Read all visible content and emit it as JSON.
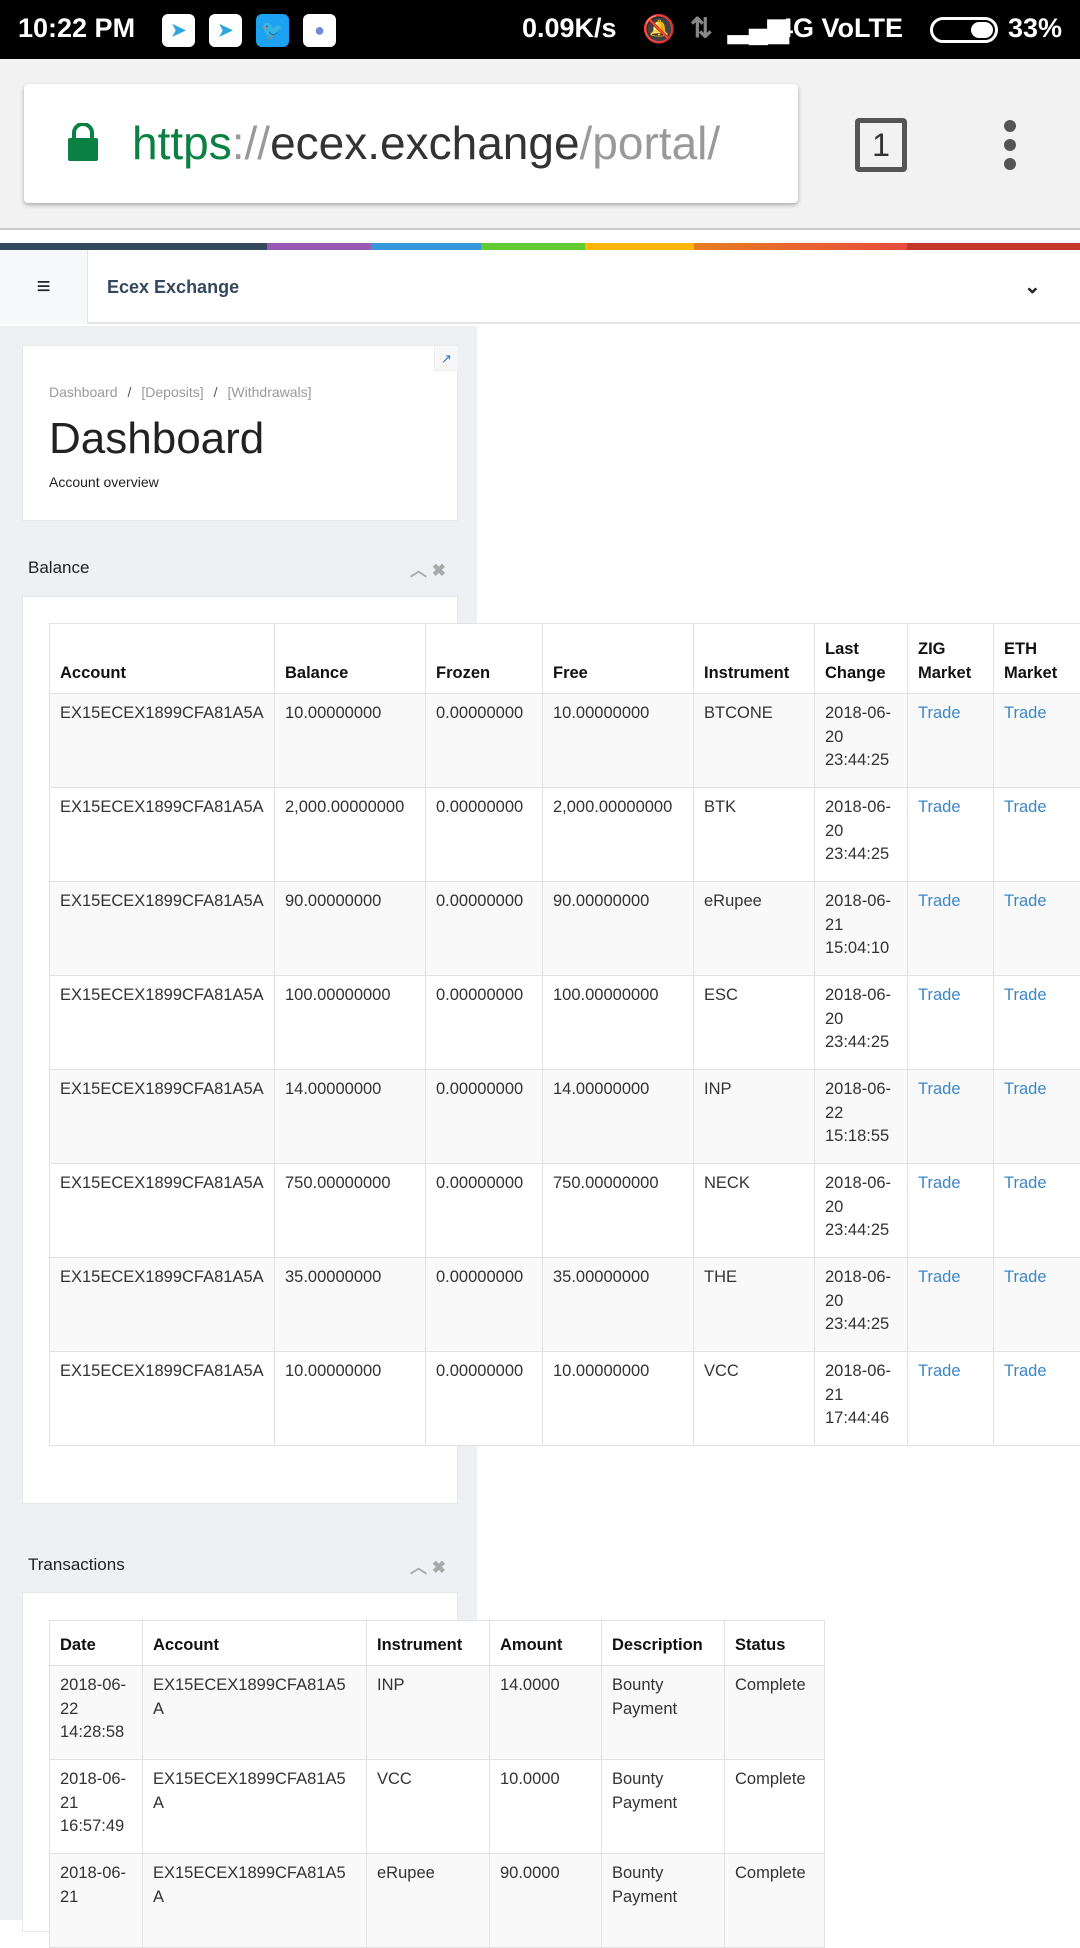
{
  "status_bar": {
    "time": "10:22 PM",
    "speed": "0.09K/s",
    "network": "4G VoLTE",
    "battery": "33%",
    "notifications": [
      "telegram-icon",
      "telegram-icon",
      "twitter-icon",
      "discord-icon"
    ]
  },
  "browser": {
    "url_scheme": "https",
    "url_sep": "://",
    "url_host": "ecex.exchange",
    "url_path": "/portal/",
    "tab_count": "1"
  },
  "colors": {
    "strip": [
      "#34495e",
      "#9b59b6",
      "#3498db",
      "#62cb31",
      "#ffb606",
      "#e67e22",
      "#e74c3c",
      "#c0392b"
    ],
    "link": "#3a87c8"
  },
  "header": {
    "brand": "Ecex Exchange"
  },
  "page": {
    "breadcrumb": [
      "Dashboard",
      "[Deposits]",
      "[Withdrawals]"
    ],
    "title": "Dashboard",
    "subtitle": "Account overview"
  },
  "balance": {
    "title": "Balance",
    "columns": [
      "Account",
      "Balance",
      "Frozen",
      "Free",
      "Instrument",
      "Last Change",
      "ZIG Market",
      "ETH Market"
    ],
    "rows": [
      [
        "EX15ECEX1899CFA81A5A",
        "10.00000000",
        "0.00000000",
        "10.00000000",
        "BTCONE",
        "2018-06-20 23:44:25",
        "Trade",
        "Trade"
      ],
      [
        "EX15ECEX1899CFA81A5A",
        "2,000.00000000",
        "0.00000000",
        "2,000.00000000",
        "BTK",
        "2018-06-20 23:44:25",
        "Trade",
        "Trade"
      ],
      [
        "EX15ECEX1899CFA81A5A",
        "90.00000000",
        "0.00000000",
        "90.00000000",
        "eRupee",
        "2018-06-21 15:04:10",
        "Trade",
        "Trade"
      ],
      [
        "EX15ECEX1899CFA81A5A",
        "100.00000000",
        "0.00000000",
        "100.00000000",
        "ESC",
        "2018-06-20 23:44:25",
        "Trade",
        "Trade"
      ],
      [
        "EX15ECEX1899CFA81A5A",
        "14.00000000",
        "0.00000000",
        "14.00000000",
        "INP",
        "2018-06-22 15:18:55",
        "Trade",
        "Trade"
      ],
      [
        "EX15ECEX1899CFA81A5A",
        "750.00000000",
        "0.00000000",
        "750.00000000",
        "NECK",
        "2018-06-20 23:44:25",
        "Trade",
        "Trade"
      ],
      [
        "EX15ECEX1899CFA81A5A",
        "35.00000000",
        "0.00000000",
        "35.00000000",
        "THE",
        "2018-06-20 23:44:25",
        "Trade",
        "Trade"
      ],
      [
        "EX15ECEX1899CFA81A5A",
        "10.00000000",
        "0.00000000",
        "10.00000000",
        "VCC",
        "2018-06-21 17:44:46",
        "Trade",
        "Trade"
      ]
    ]
  },
  "transactions": {
    "title": "Transactions",
    "columns": [
      "Date",
      "Account",
      "Instrument",
      "Amount",
      "Description",
      "Status"
    ],
    "rows": [
      [
        "2018-06-22 14:28:58",
        "EX15ECEX1899CFA81A5A",
        "INP",
        "14.0000",
        "Bounty Payment",
        "Complete"
      ],
      [
        "2018-06-21 16:57:49",
        "EX15ECEX1899CFA81A5A",
        "VCC",
        "10.0000",
        "Bounty Payment",
        "Complete"
      ],
      [
        "2018-06-21",
        "EX15ECEX1899CFA81A5A",
        "eRupee",
        "90.0000",
        "Bounty Payment",
        "Complete"
      ]
    ]
  }
}
